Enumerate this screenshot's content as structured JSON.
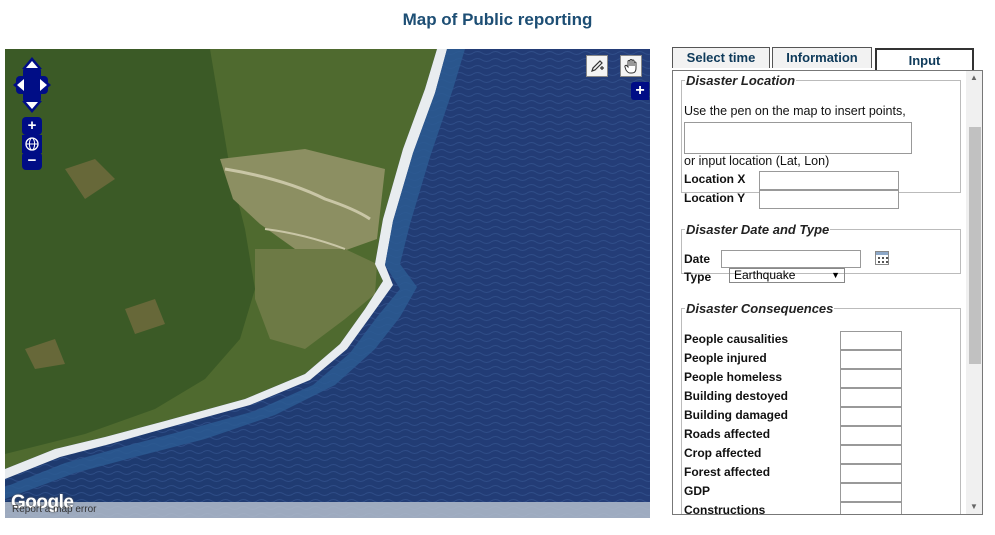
{
  "page": {
    "title": "Map of Public reporting"
  },
  "map": {
    "google_logo": "Google",
    "report_error": "Report a map error",
    "icons": {
      "pan": "pan-arrows-icon",
      "zoom_in": "+",
      "zoom_out": "−",
      "globe": "globe-icon",
      "pen": "pen-icon",
      "hand": "hand-icon",
      "layers": "+"
    }
  },
  "tabs": [
    {
      "label": "Select time"
    },
    {
      "label": "Information"
    },
    {
      "label": "Input",
      "active": true
    }
  ],
  "disaster_location": {
    "legend": "Disaster Location",
    "instruction": "Use the pen on the map to insert points,",
    "points_value": "",
    "alt_instruction": "or input location (Lat, Lon)",
    "location_x_label": "Location X",
    "location_x_value": "",
    "location_y_label": "Location Y",
    "location_y_value": ""
  },
  "disaster_date_type": {
    "legend": "Disaster Date and Type",
    "date_label": "Date",
    "date_value": "",
    "type_label": "Type",
    "type_value": "Earthquake"
  },
  "disaster_consequences": {
    "legend": "Disaster Consequences",
    "fields": [
      {
        "label": "People causalities",
        "value": ""
      },
      {
        "label": "People injured",
        "value": ""
      },
      {
        "label": "People homeless",
        "value": ""
      },
      {
        "label": "Building destoyed",
        "value": ""
      },
      {
        "label": "Building damaged",
        "value": ""
      },
      {
        "label": "Roads affected",
        "value": ""
      },
      {
        "label": "Crop affected",
        "value": ""
      },
      {
        "label": "Forest affected",
        "value": ""
      },
      {
        "label": "GDP",
        "value": ""
      },
      {
        "label": "Constructions",
        "value": ""
      }
    ]
  },
  "colors": {
    "title": "#1d4e74",
    "tab_text": "#0e3a5a",
    "map_control": "#000d86",
    "sea": "#1e3566"
  }
}
